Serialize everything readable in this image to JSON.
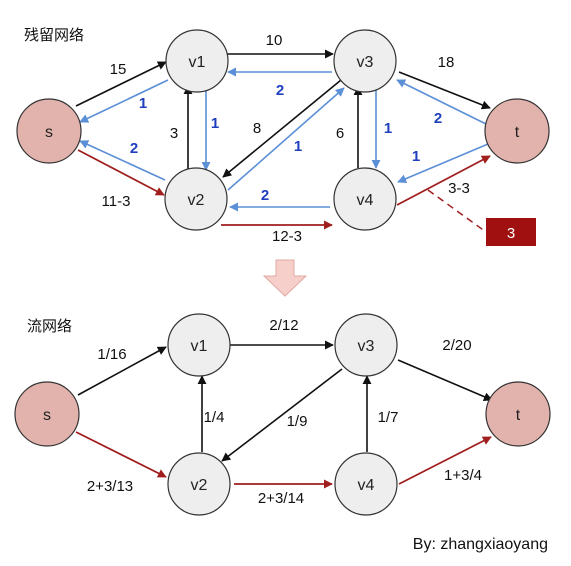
{
  "residual": {
    "title": "残留网络",
    "nodes": {
      "s": "s",
      "v1": "v1",
      "v2": "v2",
      "v3": "v3",
      "v4": "v4",
      "t": "t"
    },
    "edge_labels": {
      "s_v1": "15",
      "v1_v3": "10",
      "v3_t": "18",
      "v2_v1": "3",
      "v3_v2": "8",
      "v4_v3": "6",
      "s_v2": "11-3",
      "v2_v4": "12-3",
      "v4_t": "3-3"
    },
    "reverse_labels": {
      "v1_s": "1",
      "v1_v2": "1",
      "v2_s": "2",
      "v3_v1": "2",
      "v2_v3": "1",
      "v3_v4": "1",
      "t_v3": "2",
      "t_v4": "1",
      "v4_v2": "2"
    },
    "bottleneck_box": "3"
  },
  "flow": {
    "title": "流网络",
    "nodes": {
      "s": "s",
      "v1": "v1",
      "v2": "v2",
      "v3": "v3",
      "v4": "v4",
      "t": "t"
    },
    "edge_labels": {
      "s_v1": "1/16",
      "v1_v3": "2/12",
      "v3_t": "2/20",
      "v2_v1": "1/4",
      "v3_v2": "1/9",
      "v4_v3": "1/7",
      "s_v2": "2+3/13",
      "v2_v4": "2+3/14",
      "v4_t": "1+3/4"
    }
  },
  "credit": "By: zhangxiaoyang",
  "colors": {
    "node_fill": "#eeeeee",
    "source_sink_fill": "#e2b3ad",
    "black_edge": "#111111",
    "blue_edge": "#5b8fd6",
    "red_edge": "#a01e1e",
    "box_fill": "#a01010",
    "down_arrow_fill": "#f6cfcb",
    "blue_label": "#1f3fbf"
  }
}
